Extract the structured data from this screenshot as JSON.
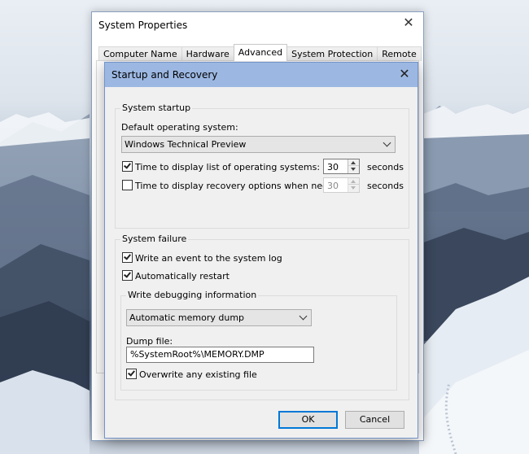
{
  "system_properties": {
    "title": "System Properties",
    "close_glyph": "✕",
    "tabs": [
      {
        "label": "Computer Name"
      },
      {
        "label": "Hardware"
      },
      {
        "label": "Advanced",
        "active": true
      },
      {
        "label": "System Protection"
      },
      {
        "label": "Remote"
      }
    ]
  },
  "dialog": {
    "title": "Startup and Recovery",
    "close_glyph": "✕",
    "system_startup": {
      "group_label": "System startup",
      "default_os_label": "Default operating system:",
      "default_os_value": "Windows Technical Preview",
      "display_list": {
        "checked": true,
        "label": "Time to display list of operating systems:",
        "value": "30",
        "unit": "seconds"
      },
      "display_recovery": {
        "checked": false,
        "label": "Time to display recovery options when needed:",
        "value": "30",
        "unit": "seconds"
      }
    },
    "system_failure": {
      "group_label": "System failure",
      "write_event": {
        "checked": true,
        "label": "Write an event to the system log"
      },
      "auto_restart": {
        "checked": true,
        "label": "Automatically restart"
      },
      "debug": {
        "group_label": "Write debugging information",
        "dump_type": "Automatic memory dump",
        "dump_file_label": "Dump file:",
        "dump_file_value": "%SystemRoot%\\MEMORY.DMP",
        "overwrite": {
          "checked": true,
          "label": "Overwrite any existing file"
        }
      }
    },
    "buttons": {
      "ok": "OK",
      "cancel": "Cancel"
    }
  },
  "colors": {
    "title_bar": "#9cb8e2",
    "dialog_bg": "#f0f0f0",
    "default_button_border": "#0078d7"
  }
}
